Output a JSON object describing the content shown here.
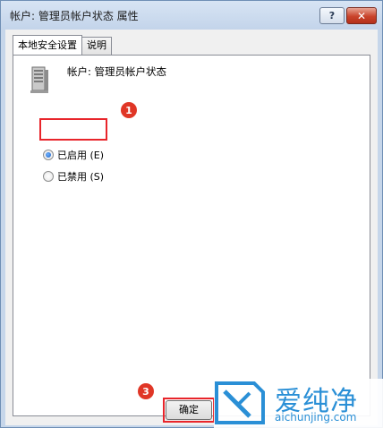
{
  "window": {
    "title": "帐户: 管理员帐户状态 属性",
    "help_label": "?",
    "close_label": "✕"
  },
  "tabs": [
    {
      "label": "本地安全设置",
      "active": true
    },
    {
      "label": "说明",
      "active": false
    }
  ],
  "panel": {
    "account_label": "帐户: 管理员帐户状态",
    "icon": "server-icon",
    "options": [
      {
        "label": "已启用 (E)",
        "checked": true
      },
      {
        "label": "已禁用 (S)",
        "checked": false
      }
    ]
  },
  "buttons": {
    "ok_label": "确定"
  },
  "annotations": {
    "step1": "1",
    "step3": "3",
    "highlight_color": "#e8252b"
  },
  "watermark": {
    "text_cn": "爱纯净",
    "text_en": "aichunjing.com",
    "color": "#2a8fd6"
  }
}
